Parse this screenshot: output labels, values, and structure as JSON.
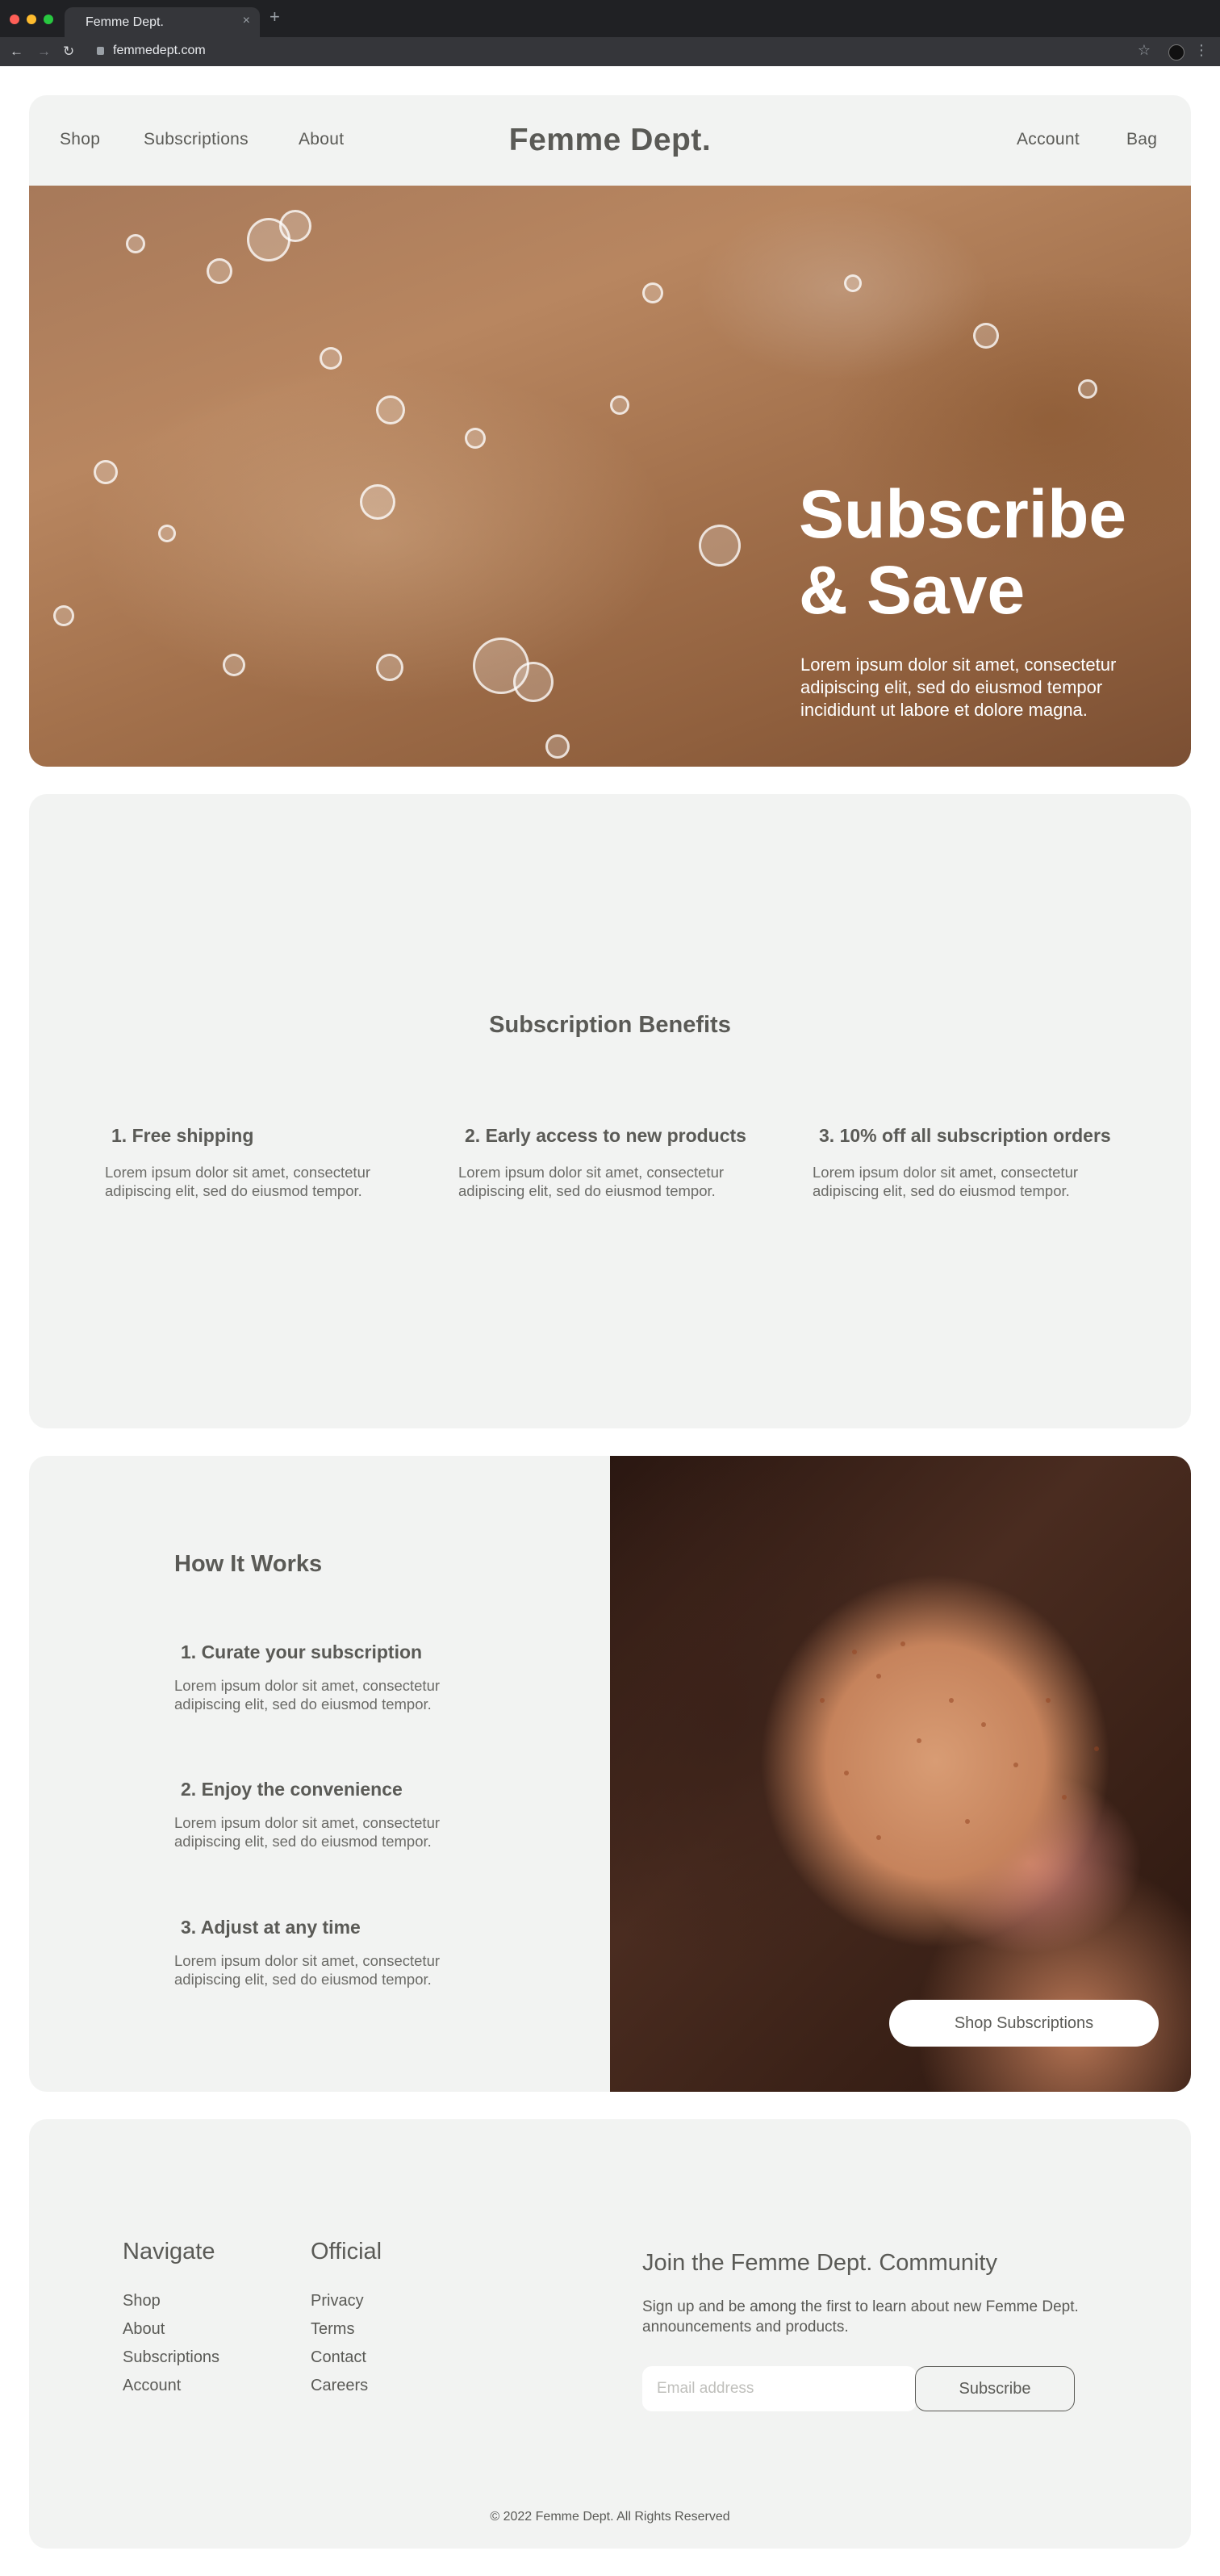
{
  "browser": {
    "tab_title": "Femme Dept.",
    "tab_close": "×",
    "new_tab": "+",
    "url": "femmedept.com",
    "back": "←",
    "forward": "→",
    "reload": "↻",
    "star": "☆",
    "menu": "⋮",
    "dot_colors": [
      "#ff5f57",
      "#febc2e",
      "#28c840"
    ]
  },
  "nav": {
    "shop": "Shop",
    "subscriptions": "Subscriptions",
    "about": "About",
    "brand": "Femme Dept.",
    "account": "Account",
    "bag": "Bag"
  },
  "hero": {
    "title_line1": "Subscribe",
    "title_line2": "& Save",
    "subtitle": "Lorem ipsum dolor sit amet, consectetur adipiscing elit, sed do eiusmod tempor incididunt ut labore et dolore magna."
  },
  "benefits": {
    "title": "Subscription Benefits",
    "items": [
      {
        "title": "1. Free shipping",
        "body": "Lorem ipsum dolor sit amet, consectetur adipiscing elit, sed do eiusmod tempor."
      },
      {
        "title": "2. Early access to new products",
        "body": "Lorem ipsum dolor sit amet, consectetur adipiscing elit, sed do eiusmod tempor."
      },
      {
        "title": "3. 10% off all subscription orders",
        "body": "Lorem ipsum dolor sit amet, consectetur adipiscing elit, sed do eiusmod tempor."
      }
    ]
  },
  "how": {
    "title": "How It Works",
    "steps": [
      {
        "title": "1. Curate your subscription",
        "body": "Lorem ipsum dolor sit amet, consectetur adipiscing elit, sed do eiusmod tempor."
      },
      {
        "title": "2. Enjoy the convenience",
        "body": "Lorem ipsum dolor sit amet, consectetur adipiscing elit, sed do eiusmod tempor."
      },
      {
        "title": "3. Adjust at any time",
        "body": "Lorem ipsum dolor sit amet, consectetur adipiscing elit, sed do eiusmod tempor."
      }
    ],
    "cta": "Shop Subscriptions"
  },
  "footer": {
    "navigate_title": "Navigate",
    "navigate_links": [
      "Shop",
      "About",
      "Subscriptions",
      "Account"
    ],
    "official_title": "Official",
    "official_links": [
      "Privacy",
      "Terms",
      "Contact",
      "Careers"
    ],
    "join_title": "Join the Femme Dept. Community",
    "join_text": "Sign up and be among the first to learn about new Femme Dept. announcements and products.",
    "email_placeholder": "Email address",
    "subscribe": "Subscribe",
    "copyright": "© 2022 Femme Dept. All Rights Reserved"
  },
  "colors": {
    "card_bg": "#f2f3f2",
    "text": "#5a5a56",
    "chrome_dark": "#202124"
  }
}
